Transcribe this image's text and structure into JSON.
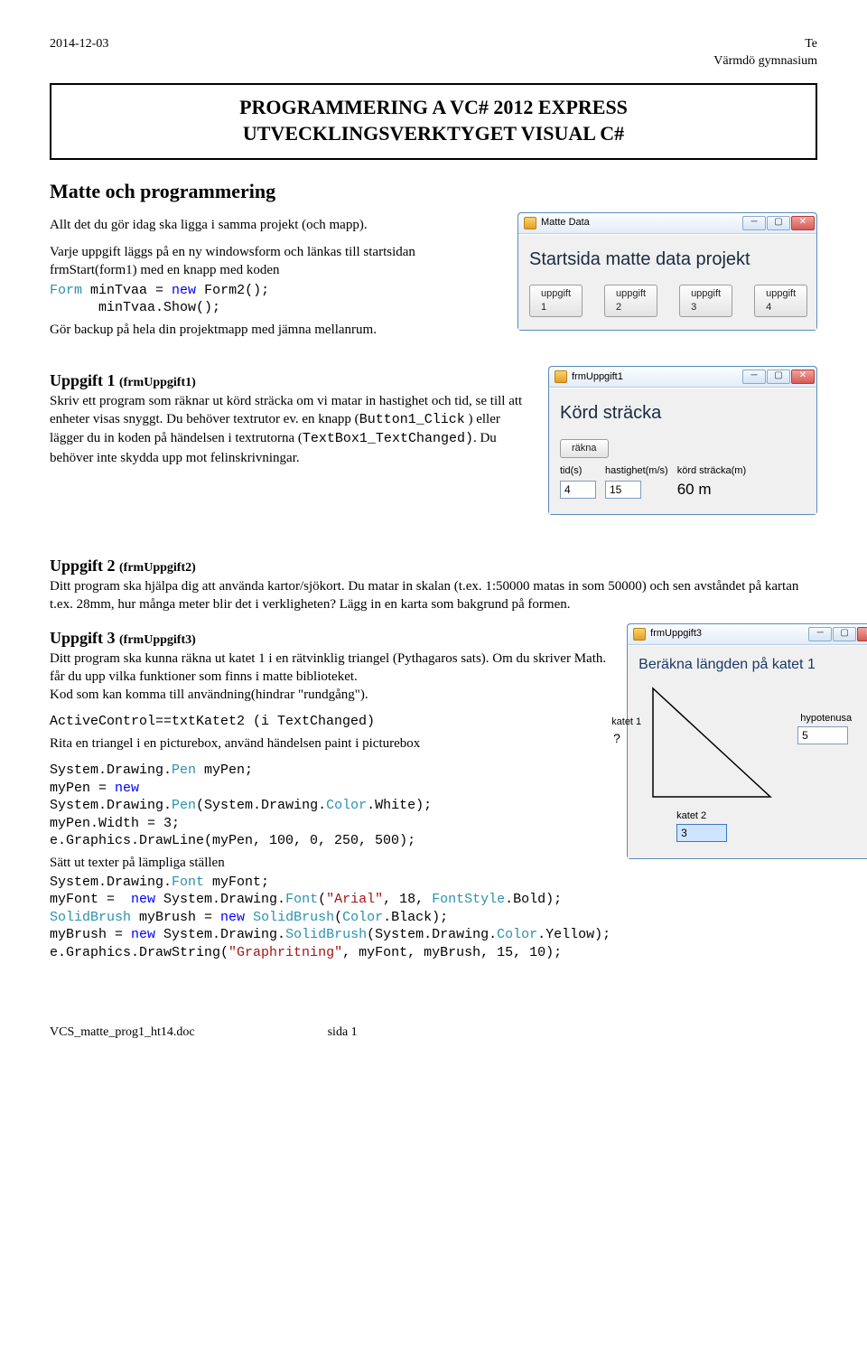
{
  "header": {
    "date": "2014-12-03",
    "course": "Te",
    "school": "Värmdö gymnasium"
  },
  "title": {
    "line1": "PROGRAMMERING A VC# 2012 EXPRESS",
    "line2": "UTVECKLINGSVERKTYGET VISUAL C#"
  },
  "section1": {
    "heading": "Matte och programmering",
    "para1": "Allt det du gör idag ska ligga i samma projekt (och mapp).",
    "para2a": "Varje uppgift läggs på  en ny windowsform och länkas till startsidan frmStart(form1) med en knapp med koden",
    "code1_kw": "Form",
    "code1_rest": " minTvaa = ",
    "code1_new": "new",
    "code1_rest2": " Form2();",
    "code2": "      minTvaa.Show();",
    "para3": "Gör backup på hela din projektmapp med jämna mellanrum."
  },
  "win_matte": {
    "title": "Matte Data",
    "heading": "Startsida matte data projekt",
    "buttons": [
      "uppgift 1",
      "uppgift 2",
      "uppgift 3",
      "uppgift 4"
    ]
  },
  "uppg1": {
    "head": "Uppgift 1 ",
    "sub": "(frmUppgift1)",
    "body1": "Skriv ett program som räknar ut körd sträcka om vi matar in hastighet och tid, se till att enheter visas snyggt. Du behöver textrutor ev. en knapp (",
    "code_a": "Button1_Click",
    "body2": " ) eller lägger du in koden på händelsen i textrutorna (",
    "code_b": "TextBox1_TextChanged)",
    "body3": ". Du behöver inte skydda upp mot felinskrivningar."
  },
  "win_u1": {
    "title": "frmUppgift1",
    "heading": "Körd sträcka",
    "btn": "räkna",
    "labels": {
      "tid": "tid(s)",
      "hast": "hastighet(m/s)",
      "res": "körd sträcka(m)"
    },
    "values": {
      "tid": "4",
      "hast": "15",
      "res": "60 m"
    }
  },
  "uppg2": {
    "head": "Uppgift 2 ",
    "sub": "(frmUppgift2)",
    "body": "Ditt program ska hjälpa dig att använda kartor/sjökort. Du matar in skalan (t.ex. 1:50000 matas in som 50000) och sen avståndet på kartan t.ex. 28mm, hur många meter blir det i verkligheten? Lägg in en karta som bakgrund på formen."
  },
  "uppg3": {
    "head": "Uppgift 3 ",
    "sub": "(frmUppgift3)",
    "body1": "Ditt program ska kunna räkna ut katet 1 i en rätvinklig triangel (Pythagaros sats). Om du skriver Math. får du upp vilka funktioner som finns i matte biblioteket.",
    "body2": "Kod som kan komma till användning(hindrar \"rundgång\").",
    "code_ac": "ActiveControl==txtKatet2 (i TextChanged)",
    "body3": "Rita en triangel i en picturebox, använd händelsen paint i picturebox"
  },
  "win_u3": {
    "title": "frmUppgift3",
    "heading": "Beräkna längden på katet 1",
    "labels": {
      "k1": "katet 1",
      "q": "?",
      "hyp": "hypotenusa",
      "k2": "katet 2"
    },
    "values": {
      "hyp": "5",
      "k2": "3"
    }
  },
  "code3": {
    "l1a": "System.Drawing.",
    "l1b": "Pen",
    "l1c": " myPen;",
    "l2a": "myPen = ",
    "l2b": "new",
    "l3a": "System.Drawing.",
    "l3b": "Pen",
    "l3c": "(System.Drawing.",
    "l3d": "Color",
    "l3e": ".White);",
    "l4": "myPen.Width = 3;",
    "l5": "e.Graphics.DrawLine(myPen, 100, 0, 250, 500);",
    "txt1": "Sätt ut texter på lämpliga ställen",
    "l6a": "System.Drawing.",
    "l6b": "Font",
    "l6c": " myFont;",
    "l7a": "myFont =  ",
    "l7b": "new",
    "l7c": " System.Drawing.",
    "l7d": "Font",
    "l7e": "(",
    "l7f": "\"Arial\"",
    "l7g": ", 18, ",
    "l7h": "FontStyle",
    "l7i": ".Bold);",
    "l8a": "SolidBrush",
    "l8b": " myBrush = ",
    "l8c": "new",
    "l8d": " ",
    "l8e": "SolidBrush",
    "l8f": "(",
    "l8g": "Color",
    "l8h": ".Black);",
    "l9a": "myBrush = ",
    "l9b": "new",
    "l9c": " System.Drawing.",
    "l9d": "SolidBrush",
    "l9e": "(System.Drawing.",
    "l9f": "Color",
    "l9g": ".Yellow);",
    "l10a": "e.Graphics.DrawString(",
    "l10b": "\"Graphritning\"",
    "l10c": ", myFont, myBrush, 15, 10);"
  },
  "footer": {
    "file": "VCS_matte_prog1_ht14.doc",
    "page": "sida 1"
  }
}
